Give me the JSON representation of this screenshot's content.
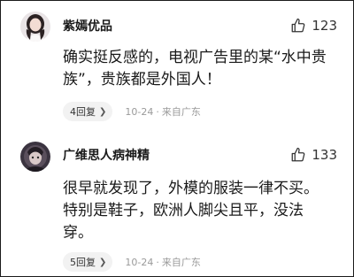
{
  "comments": [
    {
      "username": "紫嫣优品",
      "avatar_icon": "user-avatar-photo",
      "like_icon": "thumbs-up-icon",
      "likes": "123",
      "content": "确实挺反感的，电视广告里的某“水中贵族”，贵族都是外国人！",
      "reply_label": "4回复",
      "date": "10-24",
      "separator": "·",
      "location": "来自广东"
    },
    {
      "username": "广维思人病神精",
      "avatar_icon": "user-avatar-photo",
      "like_icon": "thumbs-up-icon",
      "likes": "133",
      "content": "很早就发现了，外模的服装一律不买。特别是鞋子，欧洲人脚尖且平，没法穿。",
      "reply_label": "5回复",
      "date": "10-24",
      "separator": "·",
      "location": "来自广东"
    }
  ]
}
